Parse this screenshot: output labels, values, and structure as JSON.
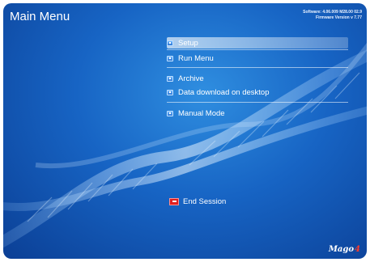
{
  "header": {
    "title": "Main Menu",
    "version_line1": "Software: 4.06.009 M28.00 02.9",
    "version_line2": "Firmware Version v 7.77"
  },
  "menu": {
    "items": [
      {
        "label": "Setup",
        "selected": true,
        "icon": "menu-item-icon"
      },
      {
        "label": "Run Menu",
        "icon": "menu-item-icon"
      },
      {
        "label": "Archive",
        "icon": "menu-item-icon"
      },
      {
        "label": "Data download on desktop",
        "icon": "menu-item-icon"
      },
      {
        "label": "Manual Mode",
        "icon": "menu-item-icon"
      }
    ],
    "end_session": {
      "label": "End Session",
      "icon": "end-session-icon"
    }
  },
  "logo": {
    "text": "Mago",
    "mark": "4"
  },
  "colors": {
    "background_dark": "#0b3f95",
    "background_light": "#2f8ee0",
    "selection": "#ffffff",
    "end_session_icon": "#e02020",
    "logo_mark": "#ff3a2a"
  }
}
